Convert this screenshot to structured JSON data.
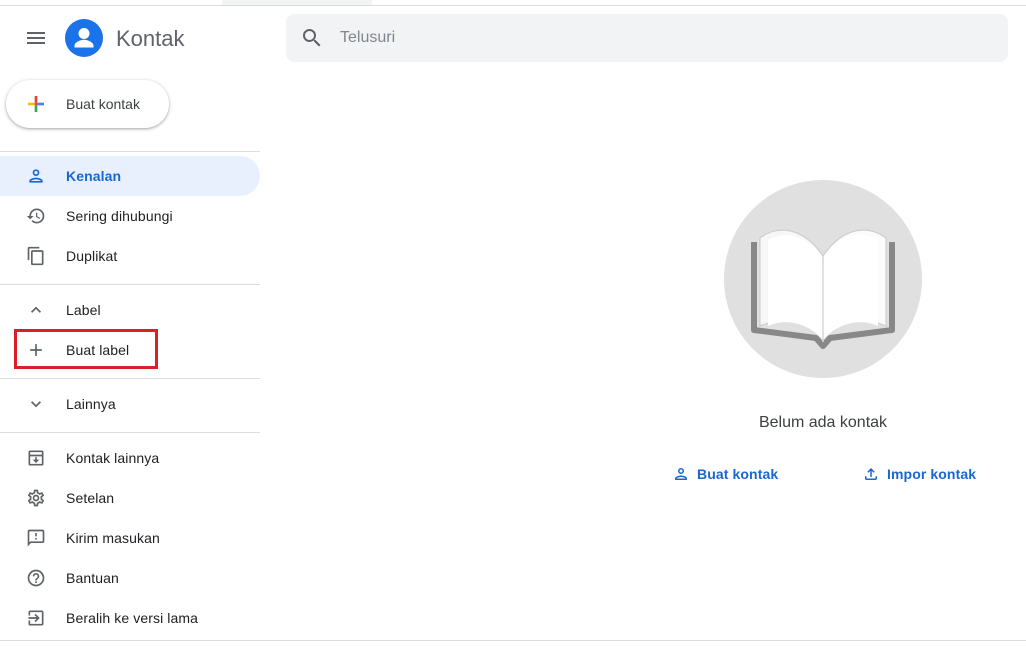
{
  "app": {
    "title": "Kontak",
    "menu_icon": "hamburger-menu-icon",
    "logo_icon": "contacts-logo-icon"
  },
  "search": {
    "placeholder": "Telusuri",
    "value": "",
    "icon": "search-icon"
  },
  "create_button": {
    "label": "Buat kontak",
    "icon": "colored-plus-icon"
  },
  "sidebar": {
    "items": [
      {
        "label": "Kenalan",
        "icon": "person-icon",
        "active": true
      },
      {
        "label": "Sering dihubungi",
        "icon": "history-icon",
        "active": false
      },
      {
        "label": "Duplikat",
        "icon": "copy-icon",
        "active": false
      }
    ],
    "label_section": {
      "header": "Label",
      "header_icon": "chevron-up-icon",
      "create_label": "Buat label",
      "create_icon": "plus-icon"
    },
    "more_section": {
      "label": "Lainnya",
      "icon": "chevron-down-icon"
    },
    "footer_items": [
      {
        "label": "Kontak lainnya",
        "icon": "archive-download-icon"
      },
      {
        "label": "Setelan",
        "icon": "gear-icon"
      },
      {
        "label": "Kirim masukan",
        "icon": "feedback-icon"
      },
      {
        "label": "Bantuan",
        "icon": "help-icon"
      },
      {
        "label": "Beralih ke versi lama",
        "icon": "exit-icon"
      }
    ]
  },
  "main": {
    "empty_state": {
      "message": "Belum ada kontak",
      "illustration": "open-book-icon"
    },
    "actions": [
      {
        "label": "Buat kontak",
        "icon": "person-add-icon"
      },
      {
        "label": "Impor kontak",
        "icon": "upload-icon"
      }
    ]
  },
  "colors": {
    "accent": "#1967d2",
    "active_bg": "#e8f0fe",
    "highlight": "#d92026",
    "logo": "#1a73e8"
  }
}
